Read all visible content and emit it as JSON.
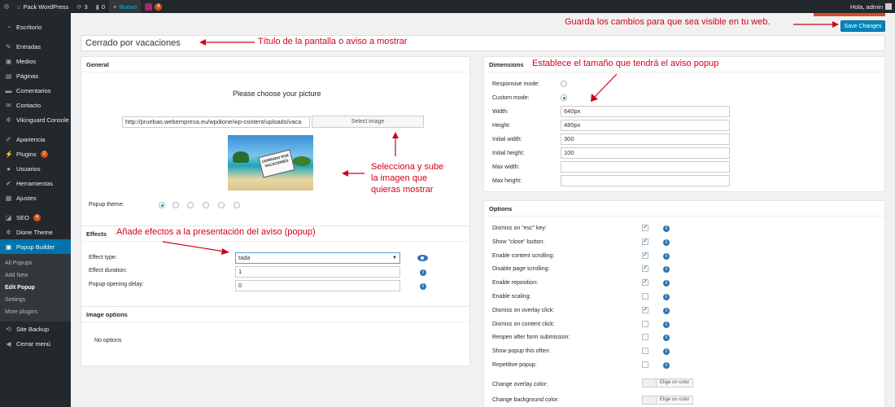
{
  "admin_bar": {
    "site_name": "Pack WordPress",
    "updates_count": "3",
    "comments_count": "0",
    "new_label": "Nuevo",
    "yoast_count": "4",
    "greeting": "Hola, admin"
  },
  "sidebar": {
    "items": [
      {
        "label": "Escritorio",
        "icon": "dashboard-icon"
      },
      {
        "label": "Entradas",
        "icon": "pin-icon"
      },
      {
        "label": "Medios",
        "icon": "media-icon"
      },
      {
        "label": "Páginas",
        "icon": "pages-icon"
      },
      {
        "label": "Comentarios",
        "icon": "comments-icon"
      },
      {
        "label": "Contacto",
        "icon": "mail-icon"
      },
      {
        "label": "Vikinguard Console",
        "icon": "gear-icon"
      },
      {
        "label": "Apariencia",
        "icon": "brush-icon"
      },
      {
        "label": "Plugins",
        "icon": "plugin-icon",
        "badge": "2"
      },
      {
        "label": "Usuarios",
        "icon": "user-icon"
      },
      {
        "label": "Herramientas",
        "icon": "wrench-icon"
      },
      {
        "label": "Ajustes",
        "icon": "settings-icon"
      },
      {
        "label": "SEO",
        "icon": "seo-icon",
        "badge": "4"
      },
      {
        "label": "Dione Theme",
        "icon": "gear-icon"
      },
      {
        "label": "Popup Builder",
        "icon": "popup-icon"
      },
      {
        "label": "Site Backup",
        "icon": "backup-icon"
      },
      {
        "label": "Cerrar menú",
        "icon": "collapse-icon"
      }
    ],
    "submenu": [
      "All Popups",
      "Add New",
      "Edit Popup",
      "Settings",
      "More plugins"
    ]
  },
  "page": {
    "popup_title": "Cerrado por vacaciones",
    "save_button": "Save Changes"
  },
  "annotations": {
    "save": "Guarda los cambios para que sea visible en tu web.",
    "title": "Título de la pantalla o aviso a mostrar",
    "dimensions": "Establece el tamaño que tendrá el aviso popup",
    "image_line1": "Selecciona y sube",
    "image_line2": "la imagen que",
    "image_line3": "quieras mostrar",
    "effects": "Añade efectos a la presentación del aviso (popup)"
  },
  "general": {
    "header": "General",
    "choose_label": "Please choose your picture",
    "image_url": "http://pruebas.webempresa.eu/wpdione/wp-content/uploads/vaca",
    "select_button": "Select image",
    "image_sign": "CERRADO POR VACACIONES",
    "theme_label": "Popup theme:",
    "theme_selected": 0
  },
  "effects": {
    "header": "Effects",
    "type_label": "Effect type:",
    "type_value": "tada",
    "duration_label": "Effect duration:",
    "duration_value": "1",
    "delay_label": "Popup opening delay:",
    "delay_value": "0"
  },
  "image_options": {
    "header": "Image options",
    "text": "No options"
  },
  "dimensions": {
    "header": "Dimensions",
    "responsive_label": "Responsive mode:",
    "custom_label": "Custom mode:",
    "width_label": "Width:",
    "width_value": "640px",
    "height_label": "Height:",
    "height_value": "480px",
    "init_width_label": "Initial width:",
    "init_width_value": "300",
    "init_height_label": "Initial height:",
    "init_height_value": "100",
    "max_width_label": "Max width:",
    "max_height_label": "Max height:"
  },
  "options": {
    "header": "Options",
    "items": [
      {
        "label": "Dismiss on \"esc\" key:",
        "checked": true
      },
      {
        "label": "Show \"close\" button:",
        "checked": true
      },
      {
        "label": "Enable content scrolling:",
        "checked": true
      },
      {
        "label": "Disable page scrolling:",
        "checked": true
      },
      {
        "label": "Enable reposition:",
        "checked": true
      },
      {
        "label": "Enable scaling:",
        "checked": false
      },
      {
        "label": "Dismiss on overlay click:",
        "checked": true
      },
      {
        "label": "Dismiss on content click:",
        "checked": false
      },
      {
        "label": "Reopen after form submission:",
        "checked": false
      },
      {
        "label": "Show popup this often:",
        "checked": false
      },
      {
        "label": "Repetitive popup:",
        "checked": false
      }
    ],
    "overlay_color_label": "Change overlay color:",
    "background_color_label": "Change background color:",
    "color_button": "Elige un color"
  },
  "colors": {
    "accent": "#0073aa",
    "annotation": "#d0021b",
    "admin_bg": "#23282d"
  }
}
